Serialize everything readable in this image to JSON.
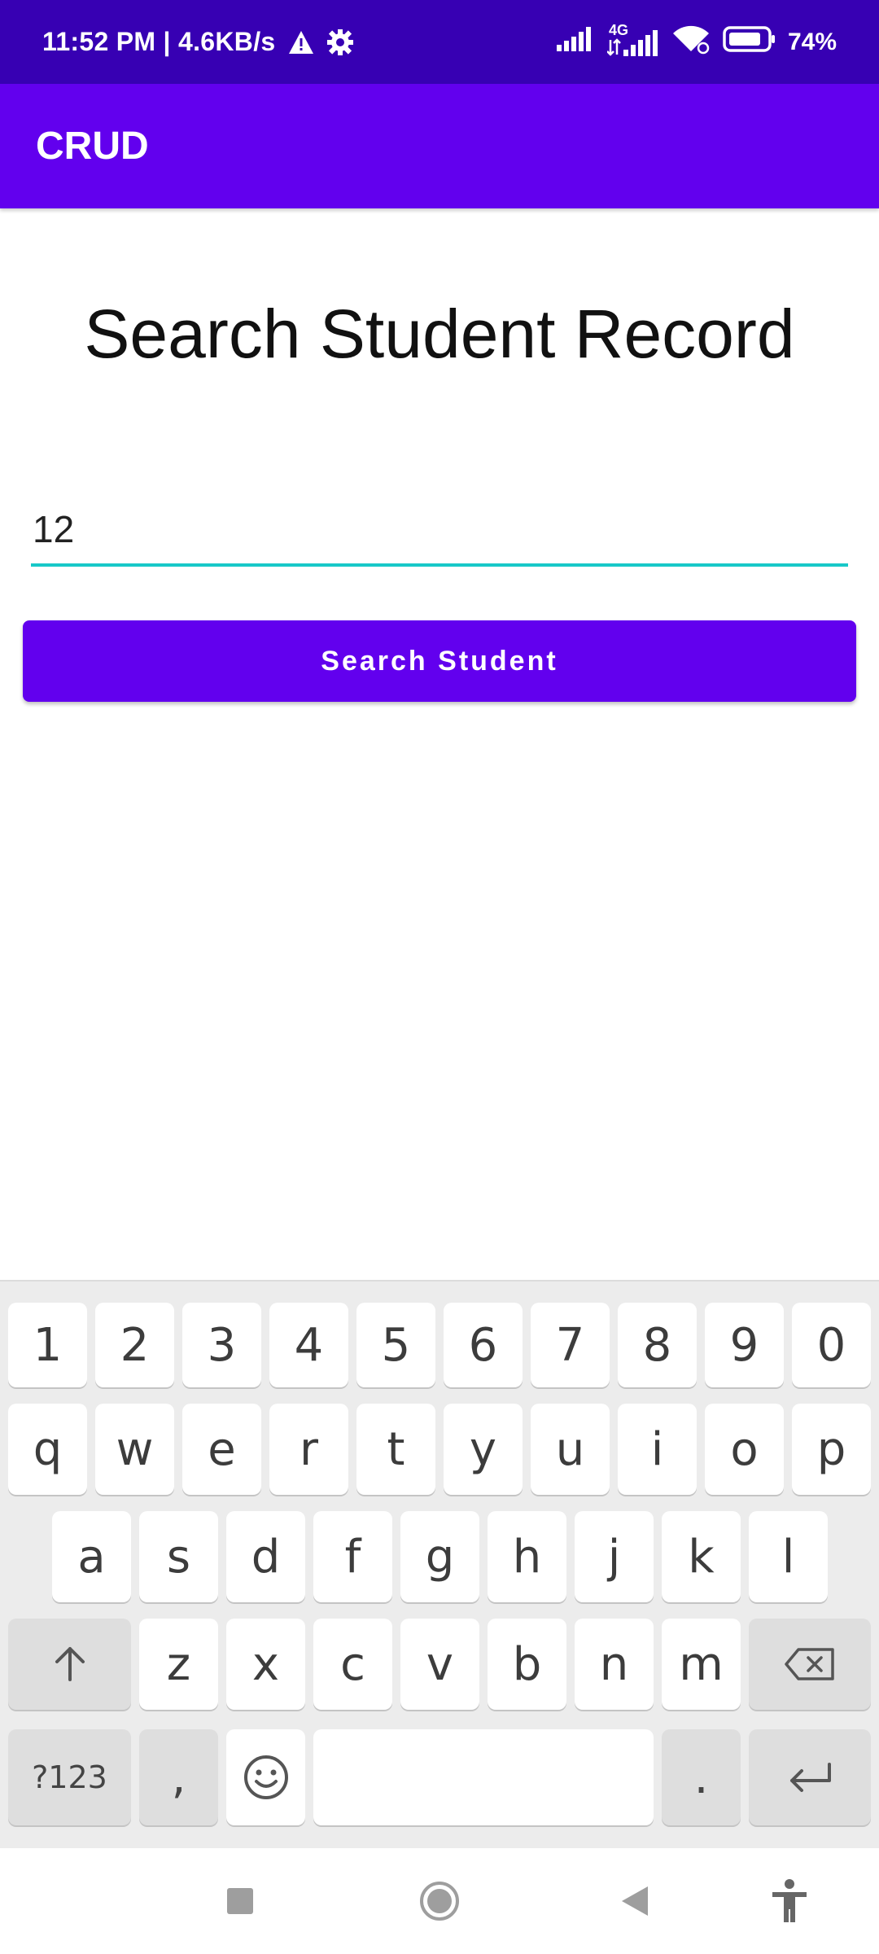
{
  "status_bar": {
    "time_speed": "11:52 PM | 4.6KB/s",
    "network": "4G",
    "battery": "74%",
    "icons": [
      "warning-icon",
      "settings-gear-icon",
      "signal-icon",
      "4g-signal-icon",
      "wifi-icon",
      "battery-icon"
    ]
  },
  "app_bar": {
    "title": "CRUD"
  },
  "main": {
    "title": "Search Student Record",
    "search_field_value": "12",
    "search_button_label": "Search Student"
  },
  "keyboard": {
    "row_numbers": [
      "1",
      "2",
      "3",
      "4",
      "5",
      "6",
      "7",
      "8",
      "9",
      "0"
    ],
    "row_1": [
      "q",
      "w",
      "e",
      "r",
      "t",
      "y",
      "u",
      "i",
      "o",
      "p"
    ],
    "row_2": [
      "a",
      "s",
      "d",
      "f",
      "g",
      "h",
      "j",
      "k",
      "l"
    ],
    "row_3": [
      "z",
      "x",
      "c",
      "v",
      "b",
      "n",
      "m"
    ],
    "symbols_label": "?123",
    "comma": ",",
    "period": ".",
    "icons": [
      "shift-icon",
      "backspace-icon",
      "emoji-icon",
      "enter-icon"
    ]
  },
  "nav_bar": {
    "icons": [
      "recents-square-icon",
      "home-circle-icon",
      "back-triangle-icon",
      "accessibility-icon"
    ]
  },
  "colors": {
    "status_bar": "#3700b3",
    "primary": "#6200ee",
    "input_underline": "#18c8c8",
    "keyboard_bg": "#ececec"
  }
}
